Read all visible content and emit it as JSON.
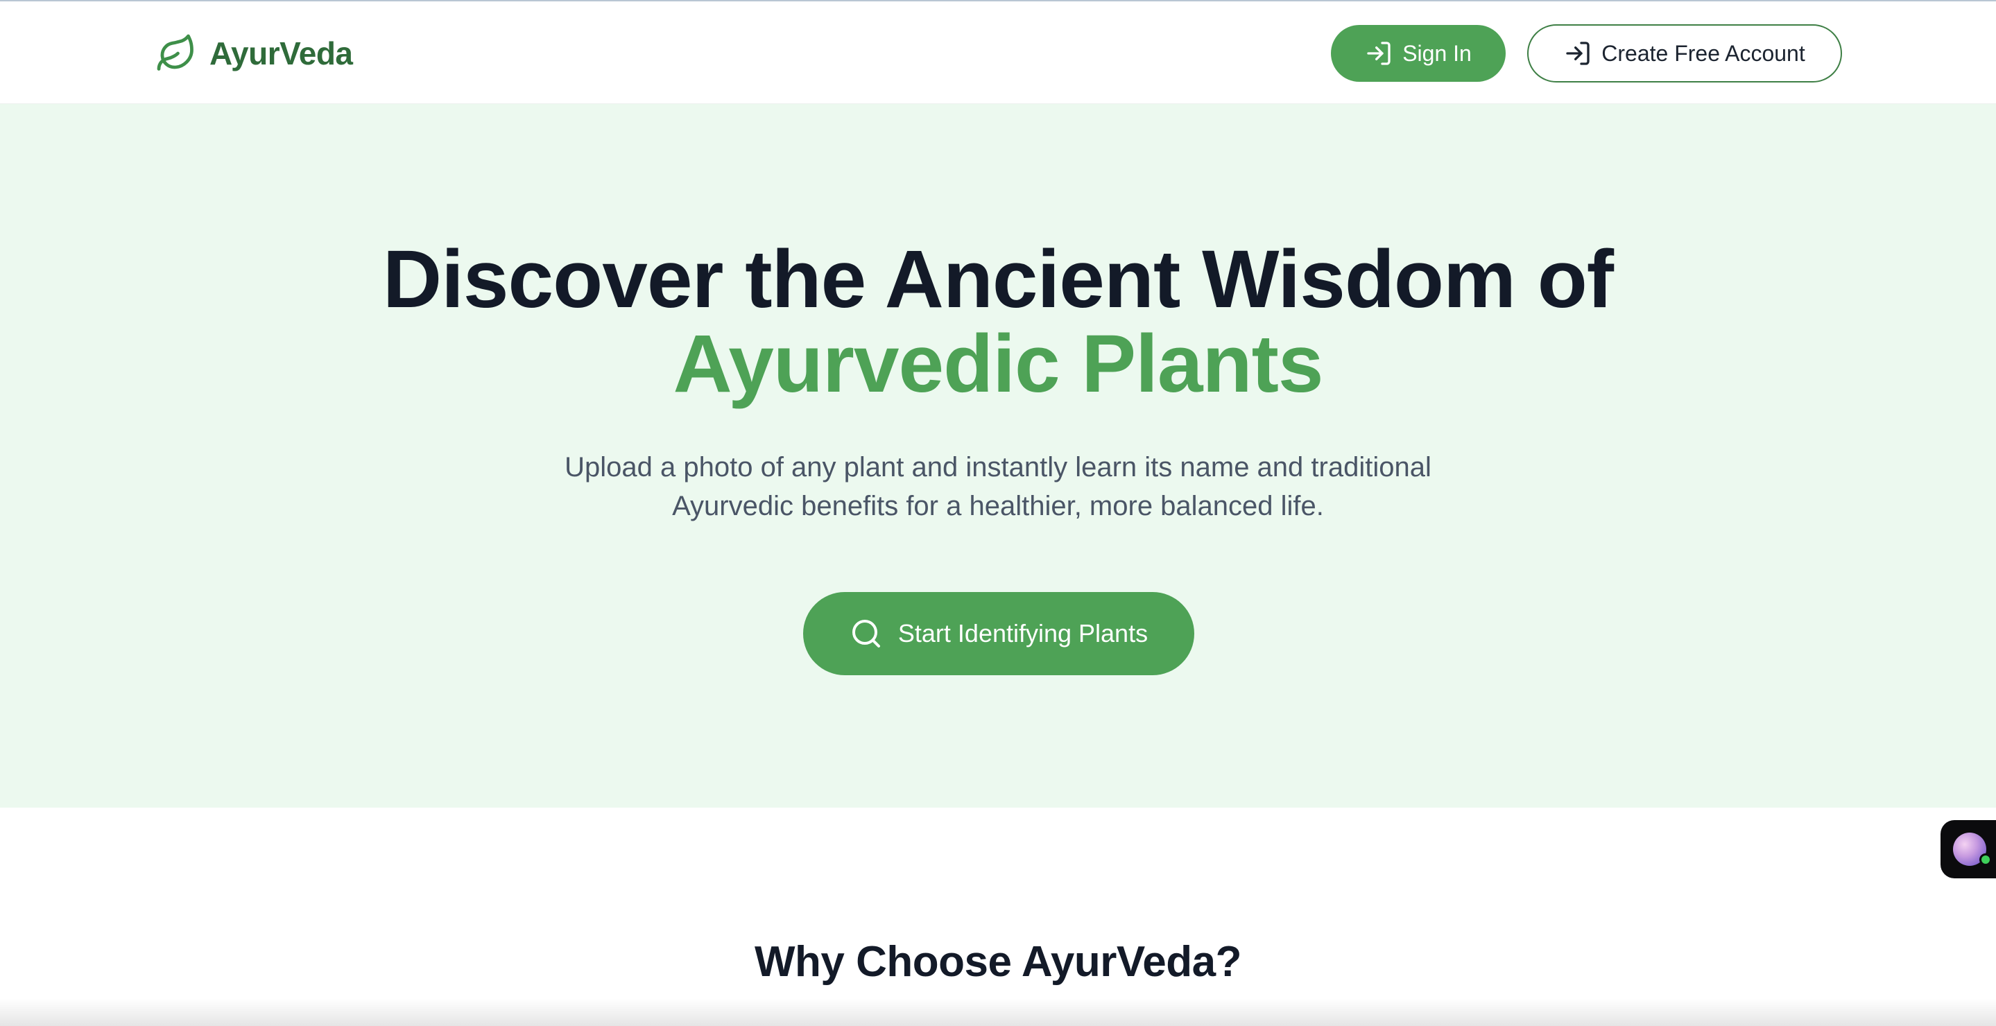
{
  "brand": {
    "name": "AyurVeda",
    "icon": "leaf-icon",
    "color": "#2f6b3a"
  },
  "header": {
    "signin_label": "Sign In",
    "signin_icon": "log-in-icon",
    "create_label": "Create Free Account",
    "create_icon": "log-in-icon"
  },
  "hero": {
    "title_line1": "Discover the Ancient Wisdom of",
    "title_line2": "Ayurvedic Plants",
    "subtitle_line1": "Upload a photo of any plant and instantly learn its name and traditional",
    "subtitle_line2": "Ayurvedic benefits for a healthier, more balanced life.",
    "cta_label": "Start Identifying Plants",
    "cta_icon": "search-icon"
  },
  "features": {
    "heading": "Why Choose AyurVeda?"
  },
  "widget": {
    "icon": "assistant-avatar-icon",
    "status_color": "#3ecf5a"
  },
  "colors": {
    "accent": "#4ea256",
    "hero_bg": "#ecf9ef",
    "title_text": "#131a28",
    "body_text": "#4a5566"
  }
}
